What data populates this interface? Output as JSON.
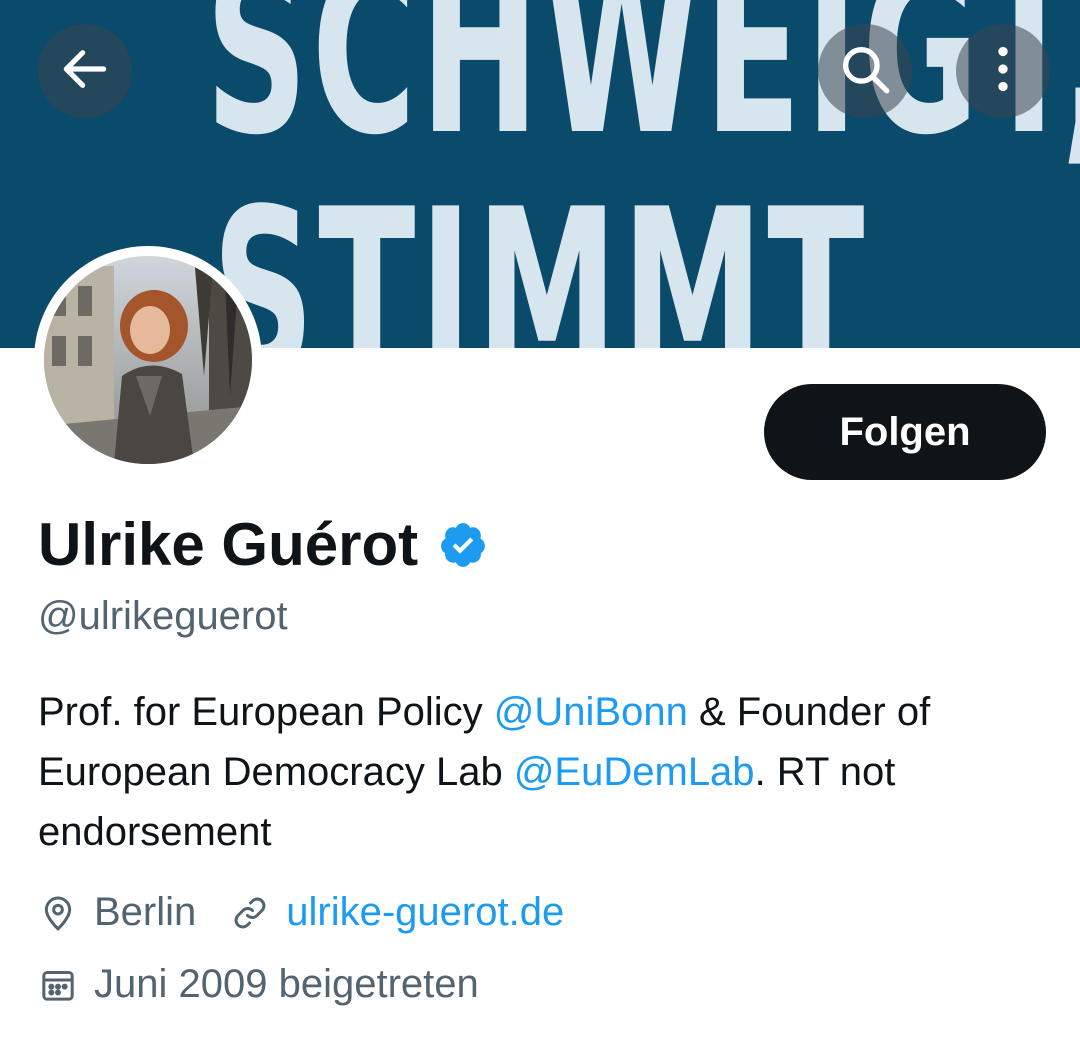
{
  "banner": {
    "line1": "SCHWEIGT,",
    "line2": "STIMMT"
  },
  "header_buttons": {
    "back": "arrow-left-icon",
    "search": "search-icon",
    "more": "more-vertical-icon"
  },
  "profile": {
    "follow_label": "Folgen",
    "display_name": "Ulrike Guérot",
    "handle": "@ulrikeguerot",
    "bio": {
      "part1": "Prof. for European Policy ",
      "mention1": "@UniBonn",
      "part2": " & Founder of European Democracy Lab ",
      "mention2": "@EuDemLab",
      "part3": ". RT not endorsement"
    },
    "location": "Berlin",
    "website": "ulrike-guerot.de",
    "joined": "Juni 2009 beigetreten"
  },
  "colors": {
    "accent": "#1d9bf0",
    "banner": "#0a4a6b",
    "text": "#0f1419",
    "secondary": "#536471"
  }
}
